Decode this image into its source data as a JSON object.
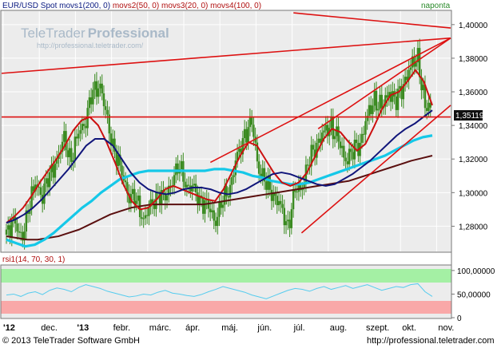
{
  "header": {
    "symbol": "EUR/USD Spot",
    "ma_labels": [
      "movs1(200, 0)",
      "movs2(50, 0)",
      "movs3(20, 0)",
      "movs4(100, 0)"
    ],
    "period": "naponta"
  },
  "watermark": {
    "brand_light": "TeleTrader",
    "brand_bold": "Professional",
    "url": "http://professional.teletrader.com/"
  },
  "rsi_panel": {
    "label": "rsi1(14, 70, 30, 1)"
  },
  "footer": {
    "copyright": "© 2013 TeleTrader Software GmbH",
    "url": "http://professional.teletrader.com"
  },
  "colors": {
    "price_bars": "#3a8a20",
    "ma_200": "#5a0f0f",
    "ma_50": "#15c8e8",
    "ma_20": "#cc1010",
    "ma_100": "#10157a",
    "trendlines": "#dd1111",
    "rsi_line": "#55ccee",
    "overbought_zone": "#a4f0a4",
    "oversold_zone": "#f9a8a8",
    "panel_bg": "#ececec"
  },
  "chart_data": [
    {
      "type": "line",
      "title": "EUR/USD Spot",
      "x_ticks": [
        "'12",
        "dec.",
        "'13",
        "febr.",
        "márc.",
        "ápr.",
        "máj.",
        "jún.",
        "júl.",
        "aug.",
        "szept.",
        "okt.",
        "nov."
      ],
      "ylim": [
        1.265,
        1.408
      ],
      "y_ticks": [
        "1,40000",
        "1,38000",
        "1,36000",
        "1,34000",
        "1,32000",
        "1,30000",
        "1,28000"
      ],
      "last_value_label": "1,35119",
      "close": [
        1.275,
        1.285,
        1.27,
        1.29,
        1.305,
        1.3,
        1.31,
        1.32,
        1.33,
        1.32,
        1.335,
        1.345,
        1.36,
        1.365,
        1.34,
        1.325,
        1.31,
        1.3,
        1.295,
        1.285,
        1.29,
        1.3,
        1.295,
        1.31,
        1.315,
        1.305,
        1.3,
        1.295,
        1.29,
        1.285,
        1.295,
        1.305,
        1.32,
        1.335,
        1.34,
        1.315,
        1.305,
        1.3,
        1.29,
        1.28,
        1.3,
        1.305,
        1.32,
        1.33,
        1.335,
        1.34,
        1.33,
        1.32,
        1.325,
        1.33,
        1.345,
        1.355,
        1.35,
        1.36,
        1.355,
        1.365,
        1.375,
        1.38,
        1.35,
        1.351
      ],
      "series": [
        {
          "name": "movs1(200, 0)",
          "values": [
            1.274,
            1.273,
            1.272,
            1.272,
            1.273,
            1.274,
            1.276,
            1.278,
            1.281,
            1.284,
            1.287,
            1.289,
            1.291,
            1.292,
            1.293,
            1.293,
            1.293,
            1.293,
            1.293,
            1.293,
            1.294,
            1.295,
            1.296,
            1.297,
            1.298,
            1.299,
            1.3,
            1.301,
            1.302,
            1.303,
            1.304,
            1.305,
            1.306,
            1.307,
            1.309,
            1.311,
            1.313,
            1.315,
            1.317,
            1.319,
            1.3205,
            1.322
          ]
        },
        {
          "name": "movs2(50, 0)",
          "values": [
            1.272,
            1.27,
            1.268,
            1.269,
            1.272,
            1.276,
            1.281,
            1.286,
            1.291,
            1.295,
            1.3,
            1.304,
            1.308,
            1.31,
            1.312,
            1.313,
            1.313,
            1.313,
            1.313,
            1.313,
            1.313,
            1.313,
            1.314,
            1.314,
            1.313,
            1.312,
            1.31,
            1.309,
            1.307,
            1.306,
            1.305,
            1.305,
            1.306,
            1.308,
            1.31,
            1.312,
            1.314,
            1.316,
            1.318,
            1.32,
            1.322,
            1.325,
            1.328,
            1.331,
            1.333,
            1.334
          ]
        },
        {
          "name": "movs3(20, 0)",
          "values": [
            1.282,
            1.286,
            1.291,
            1.298,
            1.306,
            1.313,
            1.32,
            1.328,
            1.337,
            1.343,
            1.345,
            1.34,
            1.33,
            1.318,
            1.305,
            1.295,
            1.29,
            1.291,
            1.296,
            1.302,
            1.304,
            1.302,
            1.3,
            1.298,
            1.296,
            1.295,
            1.302,
            1.312,
            1.322,
            1.33,
            1.328,
            1.32,
            1.312,
            1.306,
            1.304,
            1.306,
            1.312,
            1.322,
            1.332,
            1.338,
            1.336,
            1.33,
            1.325,
            1.329,
            1.339,
            1.35,
            1.358,
            1.36,
            1.366,
            1.373,
            1.366,
            1.352
          ]
        },
        {
          "name": "movs4(100, 0)",
          "values": [
            1.282,
            1.284,
            1.287,
            1.291,
            1.296,
            1.302,
            1.308,
            1.314,
            1.321,
            1.328,
            1.332,
            1.332,
            1.328,
            1.32,
            1.312,
            1.306,
            1.302,
            1.3,
            1.299,
            1.3,
            1.302,
            1.303,
            1.303,
            1.302,
            1.3,
            1.299,
            1.3,
            1.302,
            1.305,
            1.308,
            1.311,
            1.312,
            1.311,
            1.309,
            1.307,
            1.305,
            1.304,
            1.305,
            1.308,
            1.311,
            1.315,
            1.319,
            1.324,
            1.329,
            1.334,
            1.338,
            1.341,
            1.345,
            1.349
          ]
        }
      ],
      "trendlines": [
        {
          "from": [
            0.0,
            1.371
          ],
          "to": [
            1.0,
            1.392
          ]
        },
        {
          "from": [
            0.465,
            1.318
          ],
          "to": [
            1.0,
            1.392
          ]
        },
        {
          "from": [
            0.705,
            1.338
          ],
          "to": [
            1.0,
            1.392
          ]
        },
        {
          "from": [
            0.668,
            1.276
          ],
          "to": [
            1.0,
            1.352
          ]
        },
        {
          "from": [
            0.65,
            1.407
          ],
          "to": [
            1.0,
            1.398
          ]
        },
        {
          "from": [
            0.0,
            1.345
          ],
          "to": [
            1.0,
            1.345
          ]
        }
      ]
    },
    {
      "type": "line",
      "title": "rsi1(14, 70, 30, 1)",
      "ylim": [
        0,
        110
      ],
      "y_ticks": [
        "100,00000",
        "50,00000",
        "0"
      ],
      "overbought": 70,
      "oversold": 30,
      "values": [
        48,
        50,
        45,
        52,
        55,
        49,
        58,
        63,
        60,
        55,
        64,
        70,
        66,
        62,
        56,
        52,
        48,
        44,
        46,
        50,
        48,
        54,
        58,
        52,
        50,
        47,
        45,
        49,
        55,
        60,
        66,
        62,
        58,
        54,
        48,
        44,
        40,
        46,
        52,
        58,
        62,
        60,
        56,
        62,
        66,
        60,
        64,
        68,
        62,
        66,
        70,
        64,
        58,
        62,
        66,
        64,
        70,
        72,
        55,
        45
      ]
    }
  ]
}
